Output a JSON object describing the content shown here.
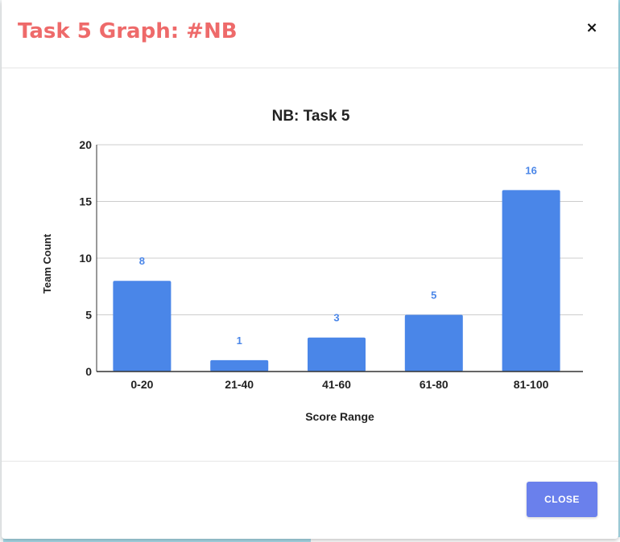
{
  "dialog": {
    "title": "Task 5 Graph: #NB",
    "close_icon": "close-icon",
    "close_glyph": "×",
    "close_button_label": "CLOSE"
  },
  "colors": {
    "title": "#ee6a6a",
    "bar": "#4a86e8",
    "data_label": "#4a86e8",
    "button": "#6a80ec"
  },
  "chart_data": {
    "type": "bar",
    "title": "NB: Task 5",
    "xlabel": "Score Range",
    "ylabel": "Team Count",
    "categories": [
      "0-20",
      "21-40",
      "41-60",
      "61-80",
      "81-100"
    ],
    "values": [
      8,
      1,
      3,
      5,
      16
    ],
    "data_labels": [
      "8",
      "1",
      "3",
      "5",
      "16"
    ],
    "ylim": [
      0,
      20
    ],
    "yticks": [
      "0",
      "5",
      "10",
      "15",
      "20"
    ],
    "grid": true,
    "legend": "none"
  }
}
